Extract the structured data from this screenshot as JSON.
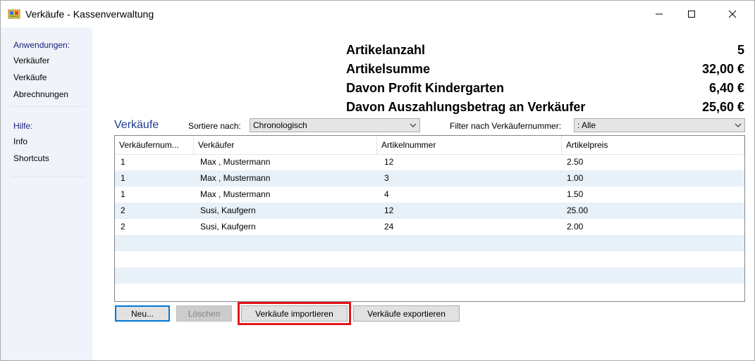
{
  "window": {
    "title": "Verkäufe - Kassenverwaltung",
    "minimize_glyph": "—",
    "maximize_glyph": "☐",
    "close_glyph": "✕"
  },
  "sidebar": {
    "groups": [
      {
        "label": "Anwendungen:",
        "items": [
          "Verkäufer",
          "Verkäufe",
          "Abrechnungen"
        ]
      },
      {
        "label": "Hilfe:",
        "items": [
          "Info",
          "Shortcuts"
        ]
      }
    ]
  },
  "summary": {
    "rows": [
      {
        "label": "Artikelanzahl",
        "value": "5"
      },
      {
        "label": "Artikelsumme",
        "value": "32,00 €"
      },
      {
        "label": "Davon Profit Kindergarten",
        "value": "6,40 €"
      },
      {
        "label": "Davon Auszahlungsbetrag an Verkäufer",
        "value": "25,60 €"
      }
    ]
  },
  "sales": {
    "title": "Verkäufe",
    "sort_label": "Sortiere nach:",
    "sort_value": "Chronologisch",
    "filter_label": "Filter nach Verkäufernummer:",
    "filter_value": ": Alle",
    "columns": [
      "Verkäufernum...",
      "Verkäufer",
      "Artikelnummer",
      "Artikelpreis"
    ],
    "rows": [
      [
        "1",
        "Max , Mustermann",
        "12",
        "2.50"
      ],
      [
        "1",
        "Max , Mustermann",
        "3",
        "1.00"
      ],
      [
        "1",
        "Max , Mustermann",
        "4",
        "1.50"
      ],
      [
        "2",
        "Susi, Kaufgern",
        "12",
        "25.00"
      ],
      [
        "2",
        "Susi, Kaufgern",
        "24",
        "2.00"
      ]
    ]
  },
  "buttons": {
    "new": "Neu...",
    "delete": "Löschen",
    "import": "Verkäufe importieren",
    "export": "Verkäufe exportieren"
  },
  "colors": {
    "accent_blue": "#1f3b8c",
    "sidebar_bg": "#f0f4fa",
    "row_alt": "#e8f0f8",
    "highlight_red": "#e0161c"
  },
  "icons": {
    "app": "app-icon",
    "dropdown": "chevron-down-icon"
  }
}
